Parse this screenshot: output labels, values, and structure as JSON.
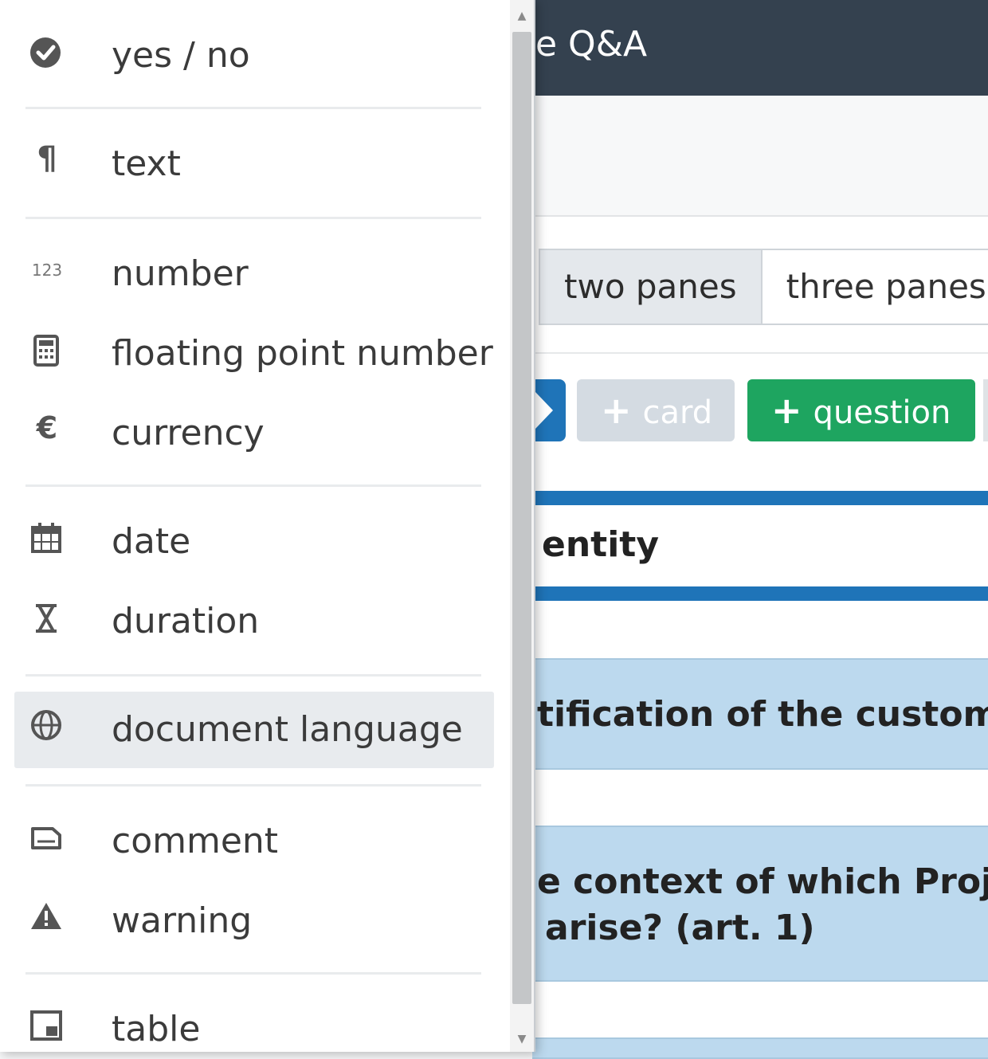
{
  "app": {
    "title": "e Q&A",
    "pane_tabs": [
      {
        "label": "two panes"
      },
      {
        "label": "three panes"
      }
    ],
    "buttons": {
      "card": "card",
      "question": "question",
      "plus": "+"
    },
    "section_heading": "entity",
    "questions": [
      {
        "line1": "tification of the customer"
      },
      {
        "line1": "e context of which Project",
        "line2": "arise? (art. 1)"
      }
    ],
    "colors": {
      "header": "#34414f",
      "accent_blue": "#1f74b8",
      "question_green": "#1ea560",
      "card_bg": "#bcd9ee"
    }
  },
  "menu": {
    "items": [
      {
        "label": "yes / no",
        "icon": "check-circle-icon"
      },
      {
        "label": "text",
        "icon": "paragraph-icon"
      },
      {
        "label": "number",
        "icon": "numbers-123-icon"
      },
      {
        "label": "floating point number",
        "icon": "calculator-icon"
      },
      {
        "label": "currency",
        "icon": "euro-icon",
        "glyph": "€"
      },
      {
        "label": "date",
        "icon": "calendar-icon"
      },
      {
        "label": "duration",
        "icon": "hourglass-icon"
      },
      {
        "label": "document language",
        "icon": "globe-icon",
        "selected": true
      },
      {
        "label": "comment",
        "icon": "comment-box-icon"
      },
      {
        "label": "warning",
        "icon": "warning-triangle-icon"
      },
      {
        "label": "table",
        "icon": "table-icon"
      }
    ],
    "glyphs": {
      "paragraph": "¶",
      "numbers": "123",
      "scroll_up": "▲",
      "scroll_down": "▼"
    }
  }
}
